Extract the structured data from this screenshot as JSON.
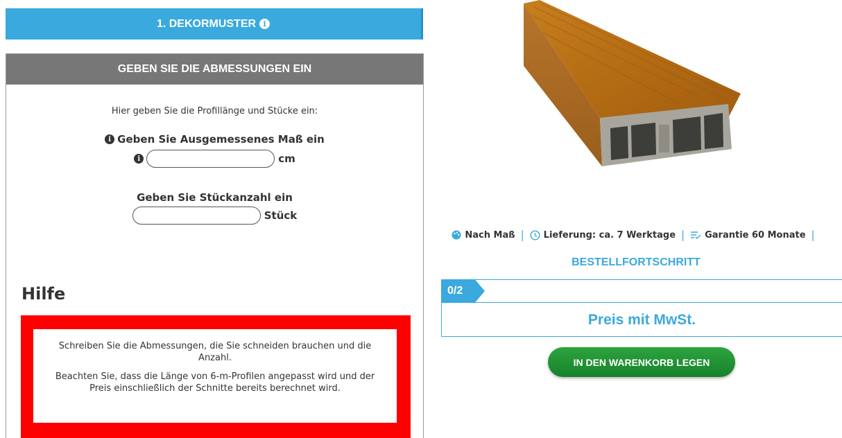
{
  "decor_section": {
    "title": "1. DEKORMUSTER",
    "info_icon": "info-circle-icon"
  },
  "dimensions": {
    "header": "GEBEN SIE DIE ABMESSUNGEN EIN",
    "intro": "Hier geben Sie die Profillänge und Stücke ein:",
    "length": {
      "label": "Geben Sie Ausgemessenes Maß ein",
      "value": "",
      "unit": "cm"
    },
    "quantity": {
      "label": "Geben Sie Stückanzahl ein",
      "value": "",
      "unit": "Stück"
    }
  },
  "help": {
    "title": "Hilfe",
    "paragraph1": "Schreiben Sie die Abmessungen, die Sie schneiden brauchen und die Anzahl.",
    "paragraph2": "Beachten Sie, dass die Länge von 6-m-Profilen angepasst wird und der Preis einschließlich der Schnitte bereits berechnet wird.",
    "border_color": "#ff0000"
  },
  "product": {
    "image_name": "wood-decor-pvc-profile"
  },
  "features": [
    {
      "icon": "palette-icon",
      "label": "Nach Maß"
    },
    {
      "icon": "clock-icon",
      "label": "Lieferung: ca. 7 Werktage"
    },
    {
      "icon": "list-check-icon",
      "label": "Garantie 60 Monate"
    }
  ],
  "progress": {
    "title": "BESTELLFORTSCHRITT",
    "step": "0/2",
    "price_label": "Preis mit MwSt."
  },
  "cart_button": {
    "label": "IN DEN WARENKORB LEGEN"
  },
  "colors": {
    "accent": "#3aa9de",
    "header_gray": "#777777",
    "button_green": "#1f8f33"
  }
}
